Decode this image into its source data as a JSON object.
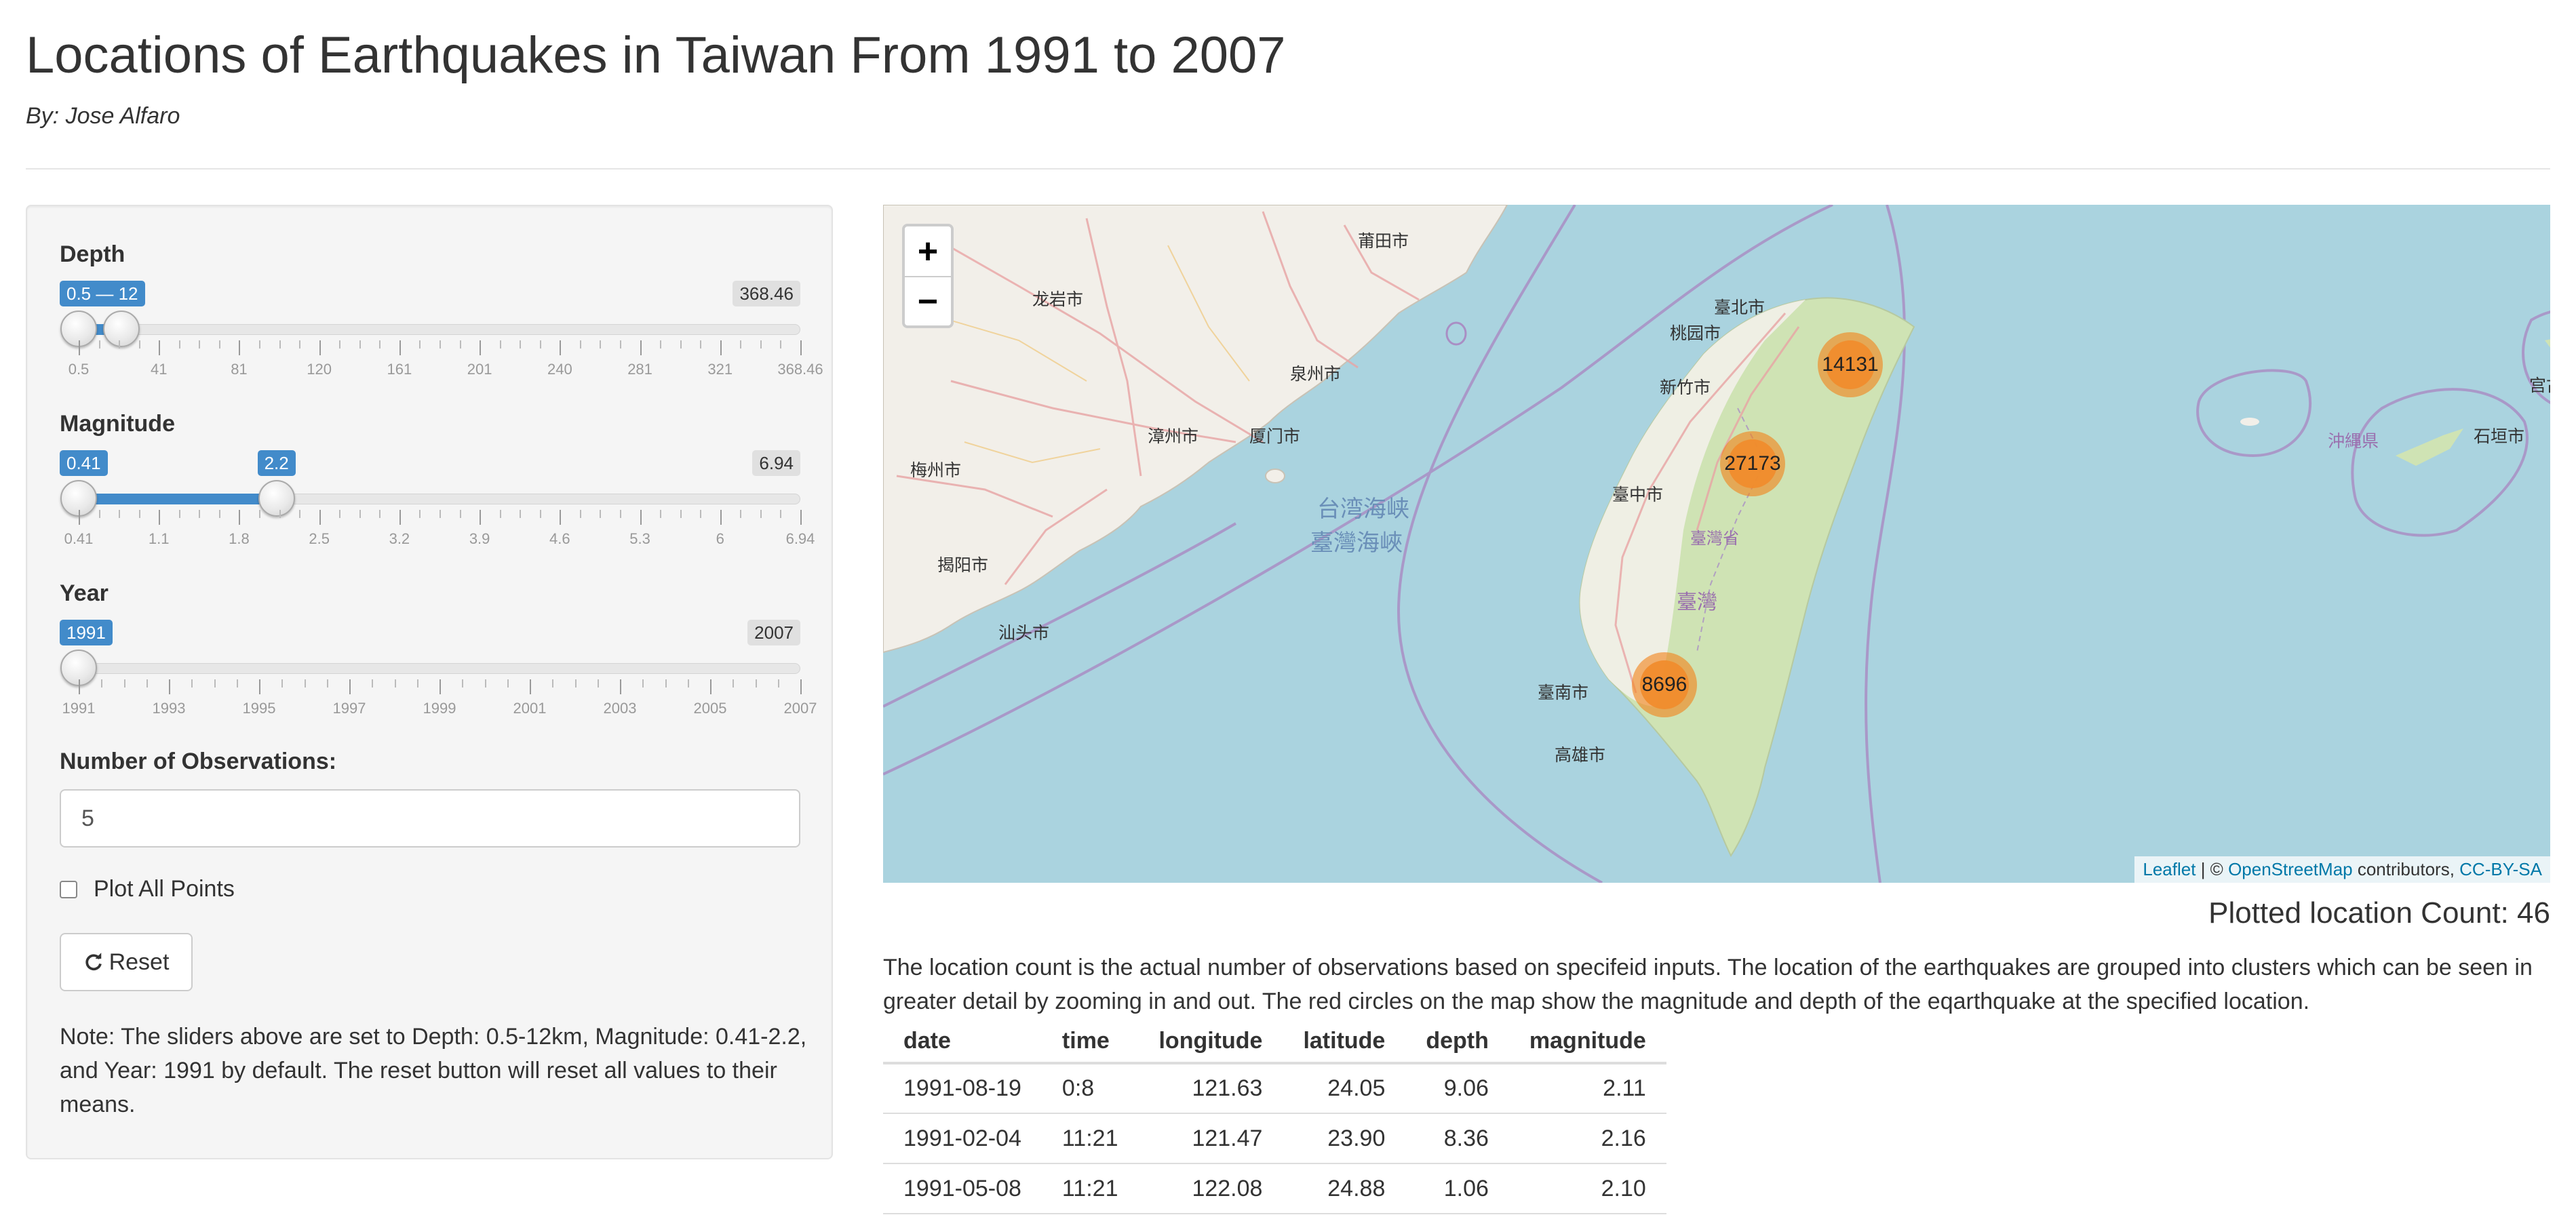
{
  "header": {
    "title": "Locations of Earthquakes in Taiwan From 1991 to 2007",
    "byline": "By: Jose Alfaro"
  },
  "sidebar": {
    "depth": {
      "label": "Depth",
      "selected_label": "0.5 — 12",
      "max_label": "368.46",
      "min": 0.5,
      "max": 368.46,
      "low": 0.5,
      "high": 12,
      "ticks": [
        "0.5",
        "41",
        "81",
        "120",
        "161",
        "201",
        "240",
        "281",
        "321",
        "368.46"
      ]
    },
    "magnitude": {
      "label": "Magnitude",
      "low_label": "0.41",
      "high_label": "2.2",
      "max_label": "6.94",
      "min": 0.41,
      "max": 6.94,
      "low": 0.41,
      "high": 2.2,
      "ticks": [
        "0.41",
        "1.1",
        "1.8",
        "2.5",
        "3.2",
        "3.9",
        "4.6",
        "5.3",
        "6",
        "6.94"
      ]
    },
    "year": {
      "label": "Year",
      "value_label": "1991",
      "max_label": "2007",
      "min": 1991,
      "max": 2007,
      "value": 1991,
      "ticks": [
        "1991",
        "1993",
        "1995",
        "1997",
        "1999",
        "2001",
        "2003",
        "2005",
        "2007"
      ]
    },
    "observations": {
      "label": "Number of Observations:",
      "value": "5"
    },
    "plot_all_label": "Plot All Points",
    "plot_all_checked": false,
    "reset_label": "Reset",
    "reset_icon": "refresh-icon",
    "note": "Note: The sliders above are set to Depth: 0.5-12km, Magnitude: 0.41-2.2, and Year: 1991 by default. The reset button will reset all values to their means."
  },
  "map": {
    "zoom_in": "+",
    "zoom_out": "−",
    "strait_label_1": "台湾海峡",
    "strait_label_2": "臺灣海峽",
    "island_label": "臺灣",
    "province_label": "臺灣省",
    "city_labels": {
      "taipei": "臺北市",
      "taoyuan": "桃园市",
      "hsinchu": "新竹市",
      "taichung": "臺中市",
      "tainan": "臺南市",
      "kaohsiung": "高雄市",
      "xiamen": "厦门市",
      "putian": "莆田市",
      "quanzhou": "泉州市",
      "zhangzhou": "漳州市",
      "shantou": "汕头市",
      "jieyang": "揭阳市",
      "meizhou": "梅州市",
      "longyan": "龙岩市",
      "okinawa": "沖縄県",
      "ishigaki": "石垣市",
      "miyakojima": "宫古島市"
    },
    "clusters": [
      {
        "label": "14131"
      },
      {
        "label": "27173"
      },
      {
        "label": "8696"
      }
    ],
    "attribution": {
      "leaflet": "Leaflet",
      "sep": " | © ",
      "osm": "OpenStreetMap",
      "contrib": " contributors, ",
      "license": "CC-BY-SA"
    },
    "colors": {
      "water": "#aad3df",
      "land": "#f2efe9",
      "island": "#cfe3b4",
      "cluster": "#f08c2d"
    }
  },
  "count_text": "Plotted location Count: 46",
  "description": "The location count is the actual number of observations based on specifeid inputs. The location of the earthquakes are grouped into clusters which can be seen in greater detail by zooming in and out. The red circles on the map show the magnitude and depth of the eqarthquake at the specified location.",
  "table": {
    "headers": [
      "date",
      "time",
      "longitude",
      "latitude",
      "depth",
      "magnitude"
    ],
    "rows": [
      [
        "1991-08-19",
        "0:8",
        "121.63",
        "24.05",
        "9.06",
        "2.11"
      ],
      [
        "1991-02-04",
        "11:21",
        "121.47",
        "23.90",
        "8.36",
        "2.16"
      ],
      [
        "1991-05-08",
        "11:21",
        "122.08",
        "24.88",
        "1.06",
        "2.10"
      ]
    ]
  }
}
